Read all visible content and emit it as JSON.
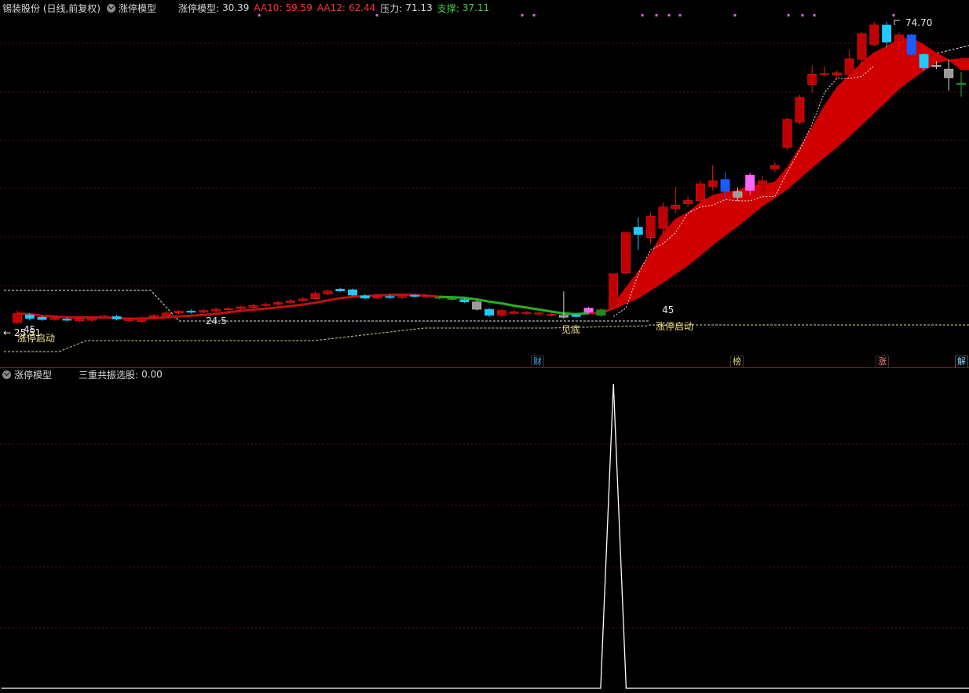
{
  "header": {
    "stock": "锡装股份 (日线,前复权)",
    "model": "涨停模型",
    "model_value_label": "涨停模型:",
    "model_value": "30.39",
    "aa10_label": "AA10:",
    "aa10_value": "59.59",
    "aa12_label": "AA12:",
    "aa12_value": "62.44",
    "pressure_label": "压力:",
    "pressure_value": "71.13",
    "support_label": "支撑:",
    "support_value": "37.11"
  },
  "main_chart": {
    "high_label": "74.70",
    "left_low_label": "← 25.51",
    "left_signal_label": "涨停启动",
    "left_num_label": "45",
    "mid_low_label": "24.5",
    "bottom_label": "见底",
    "start_num_label": "45",
    "start_label": "涨停启动",
    "event_tags": [
      "财",
      "榜",
      "涨",
      "解"
    ]
  },
  "sub_panel": {
    "model": "涨停模型",
    "indicator_label": "三重共振选股:",
    "indicator_value": "0.00"
  },
  "colors": {
    "up": "#d01010",
    "down_cyan": "#20c8ff",
    "ma_band": "#d00000",
    "dashed": "#e8e8e8",
    "grid": "#5a1010",
    "green_line": "#22b022",
    "label_yellow": "#f0e080",
    "label_red": "#ff3333",
    "label_green": "#44d044",
    "tag_blue": "#44aaff",
    "tag_yellow": "#e8d888",
    "tag_red": "#ff8888",
    "tag_cyan": "#88ddff"
  },
  "chart_data": [
    {
      "type": "candlestick",
      "title": "锡装股份 (日线,前复权)",
      "candles": [
        {
          "o": 25.6,
          "c": 27.1,
          "h": 27.6,
          "l": 25.4,
          "kind": "up"
        },
        {
          "o": 26.3,
          "c": 26.9,
          "h": 27.2,
          "l": 26.0,
          "kind": "cyan"
        },
        {
          "o": 26.5,
          "c": 26.1,
          "h": 26.8,
          "l": 25.9,
          "kind": "cyan"
        },
        {
          "o": 26.1,
          "c": 26.4,
          "h": 26.6,
          "l": 25.9,
          "kind": "up"
        },
        {
          "o": 26.2,
          "c": 26.0,
          "h": 26.5,
          "l": 25.8,
          "kind": "cyan"
        },
        {
          "o": 25.9,
          "c": 26.3,
          "h": 26.5,
          "l": 25.7,
          "kind": "up"
        },
        {
          "o": 26.0,
          "c": 26.4,
          "h": 26.6,
          "l": 25.8,
          "kind": "up"
        },
        {
          "o": 26.4,
          "c": 26.7,
          "h": 26.9,
          "l": 26.2,
          "kind": "up"
        },
        {
          "o": 26.6,
          "c": 26.2,
          "h": 26.9,
          "l": 26.0,
          "kind": "cyan"
        },
        {
          "o": 26.2,
          "c": 25.9,
          "h": 26.4,
          "l": 25.7,
          "kind": "up"
        },
        {
          "o": 25.8,
          "c": 26.4,
          "h": 26.6,
          "l": 25.6,
          "kind": "up"
        },
        {
          "o": 26.5,
          "c": 26.8,
          "h": 27.0,
          "l": 26.3,
          "kind": "up"
        },
        {
          "o": 26.7,
          "c": 27.2,
          "h": 27.5,
          "l": 26.5,
          "kind": "up"
        },
        {
          "o": 27.2,
          "c": 27.5,
          "h": 27.7,
          "l": 27.0,
          "kind": "up"
        },
        {
          "o": 27.5,
          "c": 27.3,
          "h": 27.8,
          "l": 27.1,
          "kind": "cyan"
        },
        {
          "o": 27.3,
          "c": 27.6,
          "h": 27.9,
          "l": 27.1,
          "kind": "up"
        },
        {
          "o": 27.5,
          "c": 27.8,
          "h": 28.1,
          "l": 27.3,
          "kind": "up"
        },
        {
          "o": 27.7,
          "c": 27.9,
          "h": 28.2,
          "l": 27.5,
          "kind": "up"
        },
        {
          "o": 27.9,
          "c": 28.2,
          "h": 28.4,
          "l": 27.7,
          "kind": "up"
        },
        {
          "o": 28.1,
          "c": 28.4,
          "h": 28.7,
          "l": 27.9,
          "kind": "up"
        },
        {
          "o": 28.4,
          "c": 28.6,
          "h": 28.9,
          "l": 28.2,
          "kind": "up"
        },
        {
          "o": 28.6,
          "c": 28.9,
          "h": 29.2,
          "l": 28.4,
          "kind": "up"
        },
        {
          "o": 28.9,
          "c": 29.2,
          "h": 29.5,
          "l": 28.7,
          "kind": "up"
        },
        {
          "o": 29.2,
          "c": 29.5,
          "h": 29.8,
          "l": 29.0,
          "kind": "up"
        },
        {
          "o": 29.5,
          "c": 30.4,
          "h": 30.7,
          "l": 29.3,
          "kind": "up"
        },
        {
          "o": 30.3,
          "c": 30.8,
          "h": 31.0,
          "l": 30.1,
          "kind": "up"
        },
        {
          "o": 30.8,
          "c": 31.1,
          "h": 31.3,
          "l": 30.6,
          "kind": "cyan"
        },
        {
          "o": 31.0,
          "c": 30.1,
          "h": 31.2,
          "l": 29.9,
          "kind": "cyan"
        },
        {
          "o": 30.0,
          "c": 29.6,
          "h": 30.3,
          "l": 29.4,
          "kind": "cyan"
        },
        {
          "o": 29.6,
          "c": 29.9,
          "h": 30.1,
          "l": 29.4,
          "kind": "up"
        },
        {
          "o": 29.9,
          "c": 29.7,
          "h": 30.2,
          "l": 29.5,
          "kind": "cyan"
        },
        {
          "o": 29.7,
          "c": 29.9,
          "h": 30.1,
          "l": 29.5,
          "kind": "up"
        },
        {
          "o": 29.9,
          "c": 30.1,
          "h": 30.3,
          "l": 29.7,
          "kind": "cyan"
        },
        {
          "o": 30.0,
          "c": 29.8,
          "h": 30.2,
          "l": 29.6,
          "kind": "up"
        },
        {
          "o": 29.8,
          "c": 29.6,
          "h": 30.0,
          "l": 29.4,
          "kind": "green"
        },
        {
          "o": 29.6,
          "c": 29.4,
          "h": 29.8,
          "l": 29.2,
          "kind": "green"
        },
        {
          "o": 29.4,
          "c": 29.0,
          "h": 29.6,
          "l": 28.8,
          "kind": "cyan"
        },
        {
          "o": 29.0,
          "c": 27.8,
          "h": 29.2,
          "l": 27.6,
          "kind": "white"
        },
        {
          "o": 27.8,
          "c": 26.8,
          "h": 28.0,
          "l": 26.6,
          "kind": "cyan"
        },
        {
          "o": 26.8,
          "c": 27.6,
          "h": 27.8,
          "l": 26.6,
          "kind": "up"
        },
        {
          "o": 27.4,
          "c": 27.1,
          "h": 27.7,
          "l": 26.9,
          "kind": "up"
        },
        {
          "o": 27.1,
          "c": 27.3,
          "h": 27.5,
          "l": 26.9,
          "kind": "up"
        },
        {
          "o": 27.2,
          "c": 27.0,
          "h": 27.4,
          "l": 26.8,
          "kind": "up"
        },
        {
          "o": 27.0,
          "c": 26.8,
          "h": 27.2,
          "l": 26.6,
          "kind": "up"
        },
        {
          "o": 26.8,
          "c": 26.5,
          "h": 30.7,
          "l": 26.3,
          "kind": "white"
        },
        {
          "o": 26.6,
          "c": 26.9,
          "h": 27.1,
          "l": 26.4,
          "kind": "cyan"
        },
        {
          "o": 27.3,
          "c": 28.0,
          "h": 28.2,
          "l": 27.1,
          "kind": "pink"
        },
        {
          "o": 26.8,
          "c": 27.7,
          "h": 27.9,
          "l": 26.6,
          "kind": "green"
        },
        {
          "o": 28.0,
          "c": 33.6,
          "h": 33.6,
          "l": 28.0,
          "kind": "up"
        },
        {
          "o": 33.7,
          "c": 40.3,
          "h": 40.5,
          "l": 33.5,
          "kind": "up"
        },
        {
          "o": 41.2,
          "c": 40.0,
          "h": 42.8,
          "l": 37.5,
          "kind": "cyan"
        },
        {
          "o": 39.5,
          "c": 43.0,
          "h": 43.6,
          "l": 38.5,
          "kind": "up"
        },
        {
          "o": 41.0,
          "c": 44.5,
          "h": 45.2,
          "l": 40.3,
          "kind": "up"
        },
        {
          "o": 44.2,
          "c": 44.8,
          "h": 47.8,
          "l": 43.5,
          "kind": "up"
        },
        {
          "o": 45.0,
          "c": 45.6,
          "h": 46.2,
          "l": 44.5,
          "kind": "up"
        },
        {
          "o": 45.5,
          "c": 48.3,
          "h": 48.8,
          "l": 44.8,
          "kind": "up"
        },
        {
          "o": 47.8,
          "c": 48.8,
          "h": 51.3,
          "l": 47.2,
          "kind": "up"
        },
        {
          "o": 49.0,
          "c": 47.0,
          "h": 50.2,
          "l": 45.7,
          "kind": "blue"
        },
        {
          "o": 47.0,
          "c": 46.1,
          "h": 47.7,
          "l": 45.5,
          "kind": "white"
        },
        {
          "o": 47.2,
          "c": 49.7,
          "h": 50.1,
          "l": 46.5,
          "kind": "pink"
        },
        {
          "o": 46.4,
          "c": 48.8,
          "h": 49.6,
          "l": 46.2,
          "kind": "up"
        },
        {
          "o": 50.7,
          "c": 51.3,
          "h": 51.8,
          "l": 50.2,
          "kind": "up"
        },
        {
          "o": 54.2,
          "c": 58.8,
          "h": 59.1,
          "l": 53.8,
          "kind": "up"
        },
        {
          "o": 58.3,
          "c": 62.4,
          "h": 62.8,
          "l": 58.0,
          "kind": "up"
        },
        {
          "o": 64.5,
          "c": 66.2,
          "h": 67.6,
          "l": 63.2,
          "kind": "up"
        },
        {
          "o": 66.2,
          "c": 66.3,
          "h": 67.5,
          "l": 65.8,
          "kind": "up"
        },
        {
          "o": 66.0,
          "c": 66.4,
          "h": 66.8,
          "l": 65.5,
          "kind": "up"
        },
        {
          "o": 66.1,
          "c": 68.7,
          "h": 70.2,
          "l": 65.8,
          "kind": "up"
        },
        {
          "o": 68.6,
          "c": 72.8,
          "h": 73.0,
          "l": 67.6,
          "kind": "up"
        },
        {
          "o": 71.0,
          "c": 74.2,
          "h": 74.7,
          "l": 70.7,
          "kind": "up"
        },
        {
          "o": 74.2,
          "c": 71.4,
          "h": 74.7,
          "l": 70.6,
          "kind": "cyan"
        },
        {
          "o": 71.4,
          "c": 72.6,
          "h": 73.0,
          "l": 70.7,
          "kind": "up"
        },
        {
          "o": 72.6,
          "c": 69.4,
          "h": 72.8,
          "l": 69.0,
          "kind": "blue"
        },
        {
          "o": 69.4,
          "c": 67.2,
          "h": 69.6,
          "l": 66.8,
          "kind": "cyan"
        },
        {
          "o": 67.5,
          "c": 67.6,
          "h": 68.3,
          "l": 67.0,
          "kind": "white"
        },
        {
          "o": 67.0,
          "c": 65.6,
          "h": 68.5,
          "l": 63.5,
          "kind": "white"
        },
        {
          "o": 64.7,
          "c": 64.7,
          "h": 66.5,
          "l": 62.5,
          "kind": "green"
        }
      ],
      "ma_band_start_index": 48,
      "resistance": 71.13,
      "support": 37.11
    },
    {
      "type": "line",
      "title": "三重共振选股",
      "x": [
        0,
        1,
        2,
        3,
        4,
        5,
        6,
        7,
        8,
        9,
        10,
        11,
        12,
        13,
        14,
        15,
        16,
        17,
        18,
        19,
        20,
        21,
        22,
        23,
        24,
        25,
        26,
        27,
        28,
        29,
        30,
        31,
        32,
        33,
        34,
        35,
        36,
        37,
        38,
        39,
        40,
        41,
        42,
        43,
        44,
        45,
        46,
        47,
        48,
        49,
        50,
        51,
        52,
        53,
        54,
        55,
        56,
        57,
        58,
        59,
        60,
        61,
        62,
        63,
        64,
        65,
        66,
        67,
        68,
        69,
        70,
        71,
        72,
        73,
        74,
        75,
        76
      ],
      "values": [
        0,
        0,
        0,
        0,
        0,
        0,
        0,
        0,
        0,
        0,
        0,
        0,
        0,
        0,
        0,
        0,
        0,
        0,
        0,
        0,
        0,
        0,
        0,
        0,
        0,
        0,
        0,
        0,
        0,
        0,
        0,
        0,
        0,
        0,
        0,
        0,
        0,
        0,
        0,
        0,
        0,
        0,
        0,
        0,
        0,
        0,
        0,
        0,
        1,
        0,
        0,
        0,
        0,
        0,
        0,
        0,
        0,
        0,
        0,
        0,
        0,
        0,
        0,
        0,
        0,
        0,
        0,
        0,
        0,
        0,
        0,
        0,
        0,
        0,
        0,
        0,
        0
      ],
      "ylim": [
        0,
        1
      ]
    }
  ]
}
